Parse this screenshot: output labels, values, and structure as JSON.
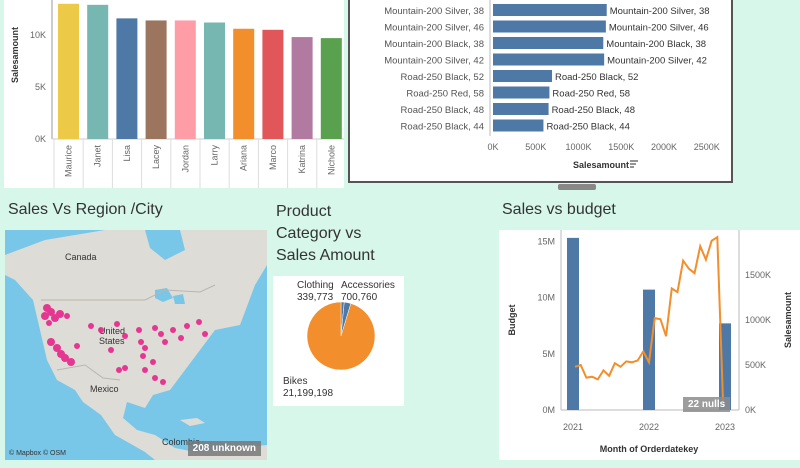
{
  "employee_chart": {
    "ylabel": "Salesamount",
    "yticks": [
      "0K",
      "5K",
      "10K"
    ],
    "bars": [
      {
        "name": "Maurice",
        "value": 13.0,
        "color": "#edc948"
      },
      {
        "name": "Janet",
        "value": 12.9,
        "color": "#76b7b2"
      },
      {
        "name": "Lisa",
        "value": 11.6,
        "color": "#4e79a7"
      },
      {
        "name": "Lacey",
        "value": 11.4,
        "color": "#9c755f"
      },
      {
        "name": "Jordan",
        "value": 11.4,
        "color": "#ff9da7"
      },
      {
        "name": "Larry",
        "value": 11.2,
        "color": "#76b7b2"
      },
      {
        "name": "Ariana",
        "value": 10.6,
        "color": "#f28e2b"
      },
      {
        "name": "Marco",
        "value": 10.5,
        "color": "#e15759"
      },
      {
        "name": "Katrina",
        "value": 9.8,
        "color": "#b07aa1"
      },
      {
        "name": "Nichole",
        "value": 9.7,
        "color": "#59a14f"
      }
    ]
  },
  "product_chart": {
    "xlabel": "Salesamount",
    "xticks": [
      "0K",
      "500K",
      "1000K",
      "1500K",
      "2000K",
      "2500K"
    ],
    "rows": [
      {
        "label": "Mountain-200 Silver, 38",
        "value": 1330
      },
      {
        "label": "Mountain-200 Silver, 46",
        "value": 1320
      },
      {
        "label": "Mountain-200 Black, 38",
        "value": 1290
      },
      {
        "label": "Mountain-200 Silver, 42",
        "value": 1300
      },
      {
        "label": "Road-250 Black, 52",
        "value": 690
      },
      {
        "label": "Road-250 Red, 58",
        "value": 660
      },
      {
        "label": "Road-250 Black, 48",
        "value": 650
      },
      {
        "label": "Road-250 Black, 44",
        "value": 590
      }
    ]
  },
  "map": {
    "title": "Sales Vs Region /City",
    "labels": {
      "canada": "Canada",
      "us1": "United",
      "us2": "States",
      "mexico": "Mexico",
      "colombia": "Colombia"
    },
    "attribution": "© Mapbox © OSM",
    "unknown_badge": "208 unknown"
  },
  "pie": {
    "title_line1": "Product",
    "title_line2": "Category vs",
    "title_line3": "Sales Amount",
    "slices": [
      {
        "name": "Clothing",
        "value": 339773,
        "label_value": "339,773",
        "color": "#4e79a7"
      },
      {
        "name": "Accessories",
        "value": 700760,
        "label_value": "700,760",
        "color": "#4e79a7"
      },
      {
        "name": "Bikes",
        "value": 21199198,
        "label_value": "21,199,198",
        "color": "#f28e2b"
      }
    ]
  },
  "budget": {
    "title": "Sales vs budget",
    "ylabel_left": "Budget",
    "ylabel_right": "Salesamount",
    "xlabel": "Month of Orderdatekey",
    "left_ticks": [
      "0M",
      "5M",
      "10M",
      "15M"
    ],
    "right_ticks": [
      "0K",
      "500K",
      "1000K",
      "1500K"
    ],
    "x_ticks": [
      "2021",
      "2022",
      "2023"
    ],
    "nulls_badge": "22 nulls",
    "chart_data": {
      "type": "bar",
      "series": [
        {
          "name": "Budget",
          "x": [
            "2021",
            "2022",
            "2023"
          ],
          "values": [
            15.3,
            10.7,
            7.7
          ]
        },
        {
          "name": "Salesamount",
          "values": [
            480,
            500,
            360,
            370,
            340,
            440,
            380,
            520,
            480,
            540,
            530,
            550,
            650,
            530,
            1020,
            1010,
            820,
            1350,
            1310,
            1660,
            1570,
            1520,
            1820,
            1670,
            1880,
            1920,
            100
          ]
        }
      ],
      "ylim_left": [
        0,
        16
      ],
      "ylim_right": [
        0,
        2000
      ]
    }
  }
}
